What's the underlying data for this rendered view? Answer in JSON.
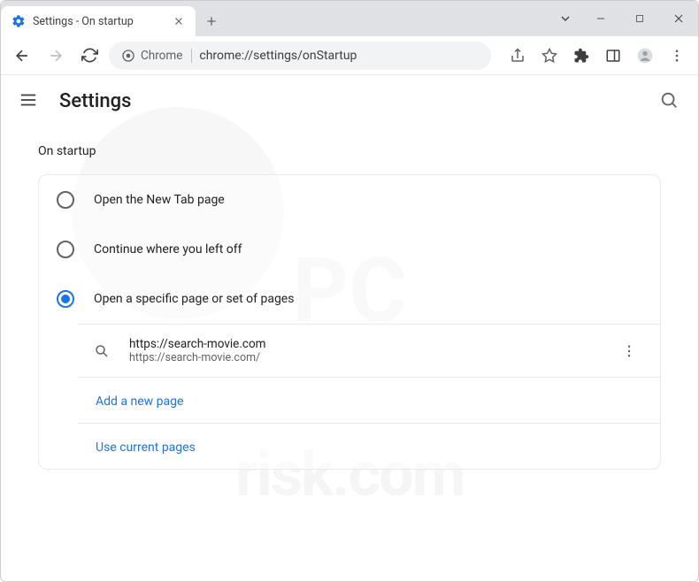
{
  "window": {
    "tab_title": "Settings - On startup"
  },
  "omnibox": {
    "chip": "Chrome",
    "url": "chrome://settings/onStartup"
  },
  "header": {
    "title": "Settings"
  },
  "section": {
    "title": "On startup",
    "options": [
      {
        "label": "Open the New Tab page",
        "selected": false
      },
      {
        "label": "Continue where you left off",
        "selected": false
      },
      {
        "label": "Open a specific page or set of pages",
        "selected": true
      }
    ],
    "startup_pages": [
      {
        "title": "https://search-movie.com",
        "url": "https://search-movie.com/"
      }
    ],
    "add_page_label": "Add a new page",
    "use_current_label": "Use current pages"
  }
}
